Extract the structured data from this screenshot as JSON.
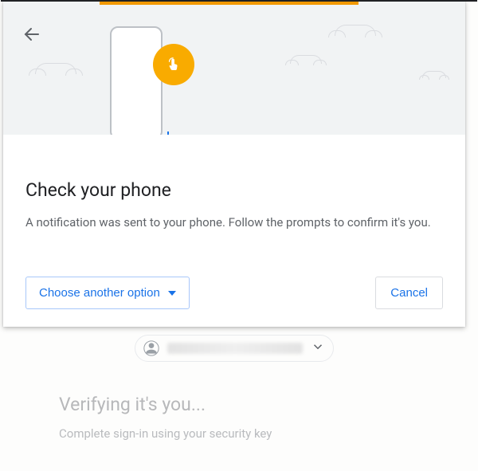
{
  "modal": {
    "title": "Check your phone",
    "description": "A notification was sent to your phone. Follow the prompts to confirm it's you.",
    "choose_another": "Choose another option",
    "cancel": "Cancel"
  },
  "background": {
    "verifying": "Verifying it's you...",
    "instruction": "Complete sign-in using your security key"
  },
  "colors": {
    "accent_orange": "#f9ab00",
    "link_blue": "#1a73e8"
  }
}
